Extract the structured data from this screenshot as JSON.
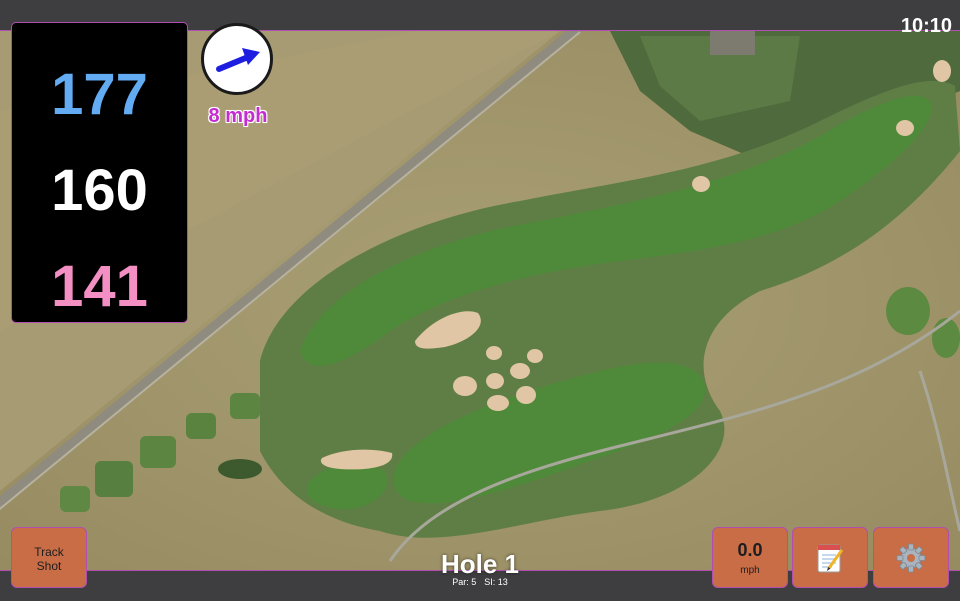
{
  "status_bar": {
    "time": "10:10"
  },
  "distances": {
    "back": "177",
    "middle": "160",
    "front": "141"
  },
  "wind": {
    "speed": "8 mph",
    "direction": "east-northeast",
    "icon": "wind-arrow-icon"
  },
  "hole": {
    "title": "Hole 1",
    "par_label": "Par: 5",
    "si_label": "SI: 13"
  },
  "buttons": {
    "track_shot": "Track\nShot",
    "speed_value": "0.0",
    "speed_unit": "mph",
    "notes_icon": "notepad-icon",
    "settings_icon": "gear-icon"
  },
  "colors": {
    "back_distance": "#63abf2",
    "middle_distance": "#ffffff",
    "front_distance": "#f48fc4",
    "accent_border": "#b14fb0",
    "button_bg": "#c96d47",
    "wind_text": "#c42bd1"
  }
}
